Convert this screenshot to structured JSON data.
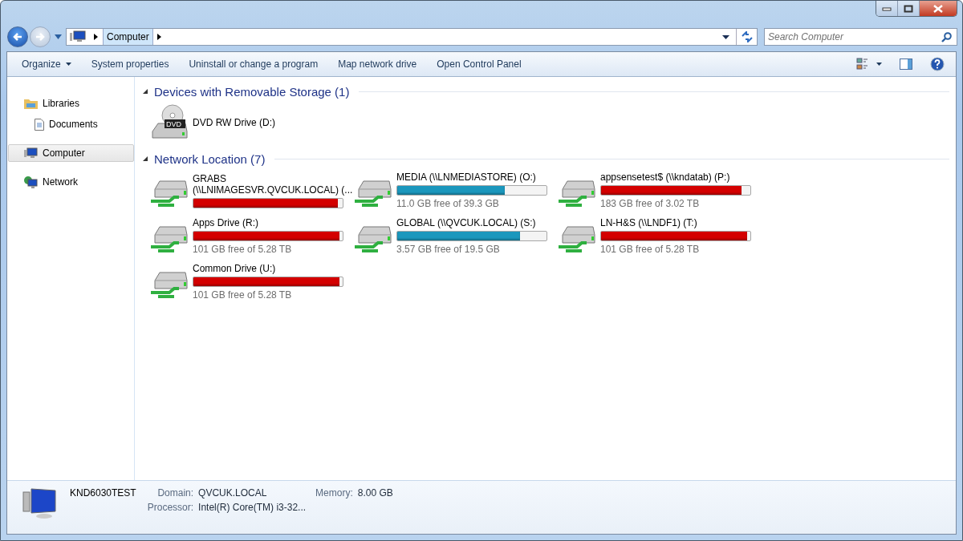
{
  "address_bar": {
    "breadcrumbs": [
      "Computer"
    ]
  },
  "search": {
    "placeholder": "Search Computer"
  },
  "toolbar": {
    "items": [
      {
        "label": "Organize",
        "dropdown": true
      },
      {
        "label": "System properties",
        "dropdown": false
      },
      {
        "label": "Uninstall or change a program",
        "dropdown": false
      },
      {
        "label": "Map network drive",
        "dropdown": false
      },
      {
        "label": "Open Control Panel",
        "dropdown": false
      }
    ]
  },
  "sidebar": {
    "items": [
      {
        "label": "Libraries",
        "kind": "library",
        "selected": false,
        "children": [
          {
            "label": "Documents",
            "kind": "document",
            "selected": false
          }
        ]
      },
      {
        "label": "Computer",
        "kind": "computer",
        "selected": true
      },
      {
        "label": "Network",
        "kind": "network",
        "selected": false
      }
    ]
  },
  "groups": [
    {
      "title": "Devices with Removable Storage (1)",
      "expanded": true,
      "items": [
        {
          "kind": "dvd",
          "badge": "DVD",
          "name": "DVD RW Drive (D:)"
        }
      ]
    },
    {
      "title": "Network Location (7)",
      "expanded": true,
      "items": [
        {
          "kind": "network",
          "name": "GRABS (\\\\LNIMAGESVR.QVCUK.LOCAL) (...",
          "level": 0.97,
          "color": "#d40000"
        },
        {
          "kind": "network",
          "name": "MEDIA (\\\\LNMEDIASTORE) (O:)",
          "level": 0.72,
          "color": "#1b97bd",
          "free": "11.0 GB free of 39.3 GB"
        },
        {
          "kind": "network",
          "name": "appsensetest$ (\\\\kndatab) (P:)",
          "level": 0.94,
          "color": "#d40000",
          "free": "183 GB free of 3.02 TB"
        },
        {
          "kind": "network",
          "name": "Apps Drive (R:)",
          "level": 0.98,
          "color": "#d40000",
          "free": "101 GB free of 5.28 TB"
        },
        {
          "kind": "network",
          "name": "GLOBAL (\\\\QVCUK.LOCAL) (S:)",
          "level": 0.82,
          "color": "#1b97bd",
          "free": "3.57 GB free of 19.5 GB"
        },
        {
          "kind": "network",
          "name": "LN-H&S (\\\\LNDF1) (T:)",
          "level": 0.98,
          "color": "#d40000",
          "free": "101 GB free of 5.28 TB"
        },
        {
          "kind": "network",
          "name": "Common Drive (U:)",
          "level": 0.98,
          "color": "#d40000",
          "free": "101 GB free of 5.28 TB"
        }
      ]
    }
  ],
  "details": {
    "computer_name": "KND6030TEST",
    "fields": [
      {
        "label": "Domain:",
        "value": "QVCUK.LOCAL"
      },
      {
        "label": "Memory:",
        "value": "8.00 GB"
      },
      {
        "label": "Processor:",
        "value": "Intel(R) Core(TM) i3-32..."
      }
    ]
  }
}
